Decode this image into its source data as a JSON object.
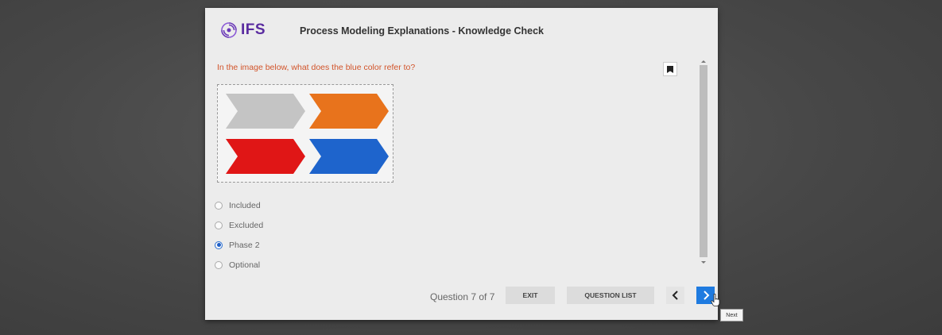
{
  "header": {
    "logo_text": "IFS",
    "title": "Process Modeling Explanations - Knowledge Check"
  },
  "question": {
    "text": "In the image below, what does the blue color refer to?",
    "image_chevrons": [
      {
        "color": "#c4c4c4",
        "name": "gray-chevron"
      },
      {
        "color": "#e8731c",
        "name": "orange-chevron"
      },
      {
        "color": "#e01616",
        "name": "red-chevron"
      },
      {
        "color": "#1e64cc",
        "name": "blue-chevron"
      }
    ]
  },
  "options": [
    {
      "label": "Included",
      "selected": false
    },
    {
      "label": "Excluded",
      "selected": false
    },
    {
      "label": "Phase 2",
      "selected": true
    },
    {
      "label": "Optional",
      "selected": false
    }
  ],
  "footer": {
    "question_count": "Question 7 of 7",
    "exit_label": "EXIT",
    "question_list_label": "QUESTION LIST",
    "prev_icon": "chevron-left-icon",
    "next_icon": "chevron-right-icon"
  },
  "tooltip": {
    "text": "Next"
  },
  "colors": {
    "brand_purple": "#5a2ca0",
    "question_text": "#d2542a",
    "next_button": "#1f7be0",
    "selected_radio": "#1e5fc8"
  }
}
